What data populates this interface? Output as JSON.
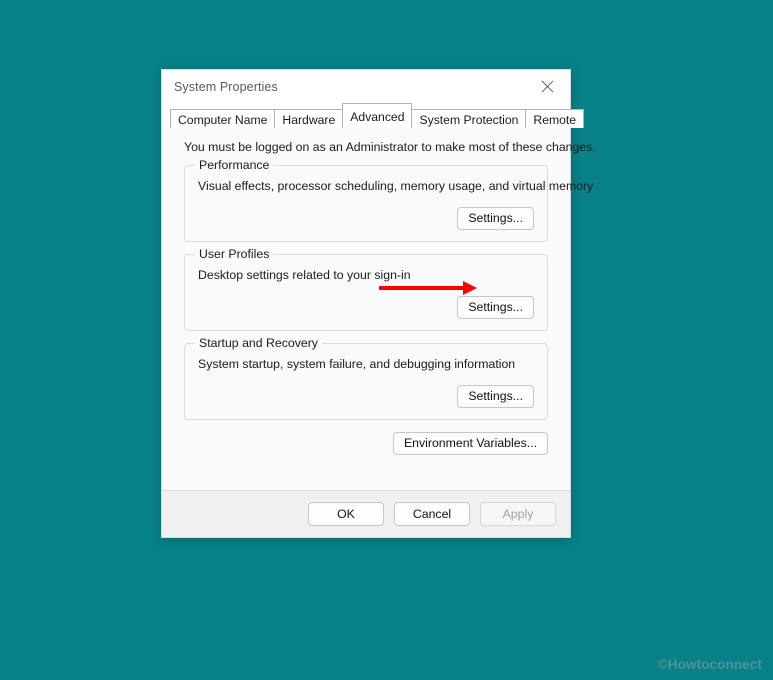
{
  "window": {
    "title": "System Properties",
    "close_icon": "close-icon"
  },
  "tabs": [
    {
      "label": "Computer Name",
      "active": false
    },
    {
      "label": "Hardware",
      "active": false
    },
    {
      "label": "Advanced",
      "active": true
    },
    {
      "label": "System Protection",
      "active": false
    },
    {
      "label": "Remote",
      "active": false
    }
  ],
  "page": {
    "intro": "You must be logged on as an Administrator to make most of these changes.",
    "groups": [
      {
        "title": "Performance",
        "description": "Visual effects, processor scheduling, memory usage, and virtual memory",
        "button": "Settings..."
      },
      {
        "title": "User Profiles",
        "description": "Desktop settings related to your sign-in",
        "button": "Settings..."
      },
      {
        "title": "Startup and Recovery",
        "description": "System startup, system failure, and debugging information",
        "button": "Settings..."
      }
    ],
    "environment_variables_button": "Environment Variables..."
  },
  "footer": {
    "ok": "OK",
    "cancel": "Cancel",
    "apply": "Apply",
    "apply_disabled": true
  },
  "annotation": {
    "arrow_color": "#fe0000",
    "target": "performance-settings-button"
  },
  "watermark": {
    "text": "©Howtoconnect",
    "color": "#4e9499"
  },
  "colors": {
    "desktop_background": "#088189",
    "dialog_background": "#fafafa",
    "titlebar_background": "#ffffff",
    "footer_background": "#f0f0f0",
    "group_border": "#dcdcdc",
    "text": "#1b1b1b"
  }
}
